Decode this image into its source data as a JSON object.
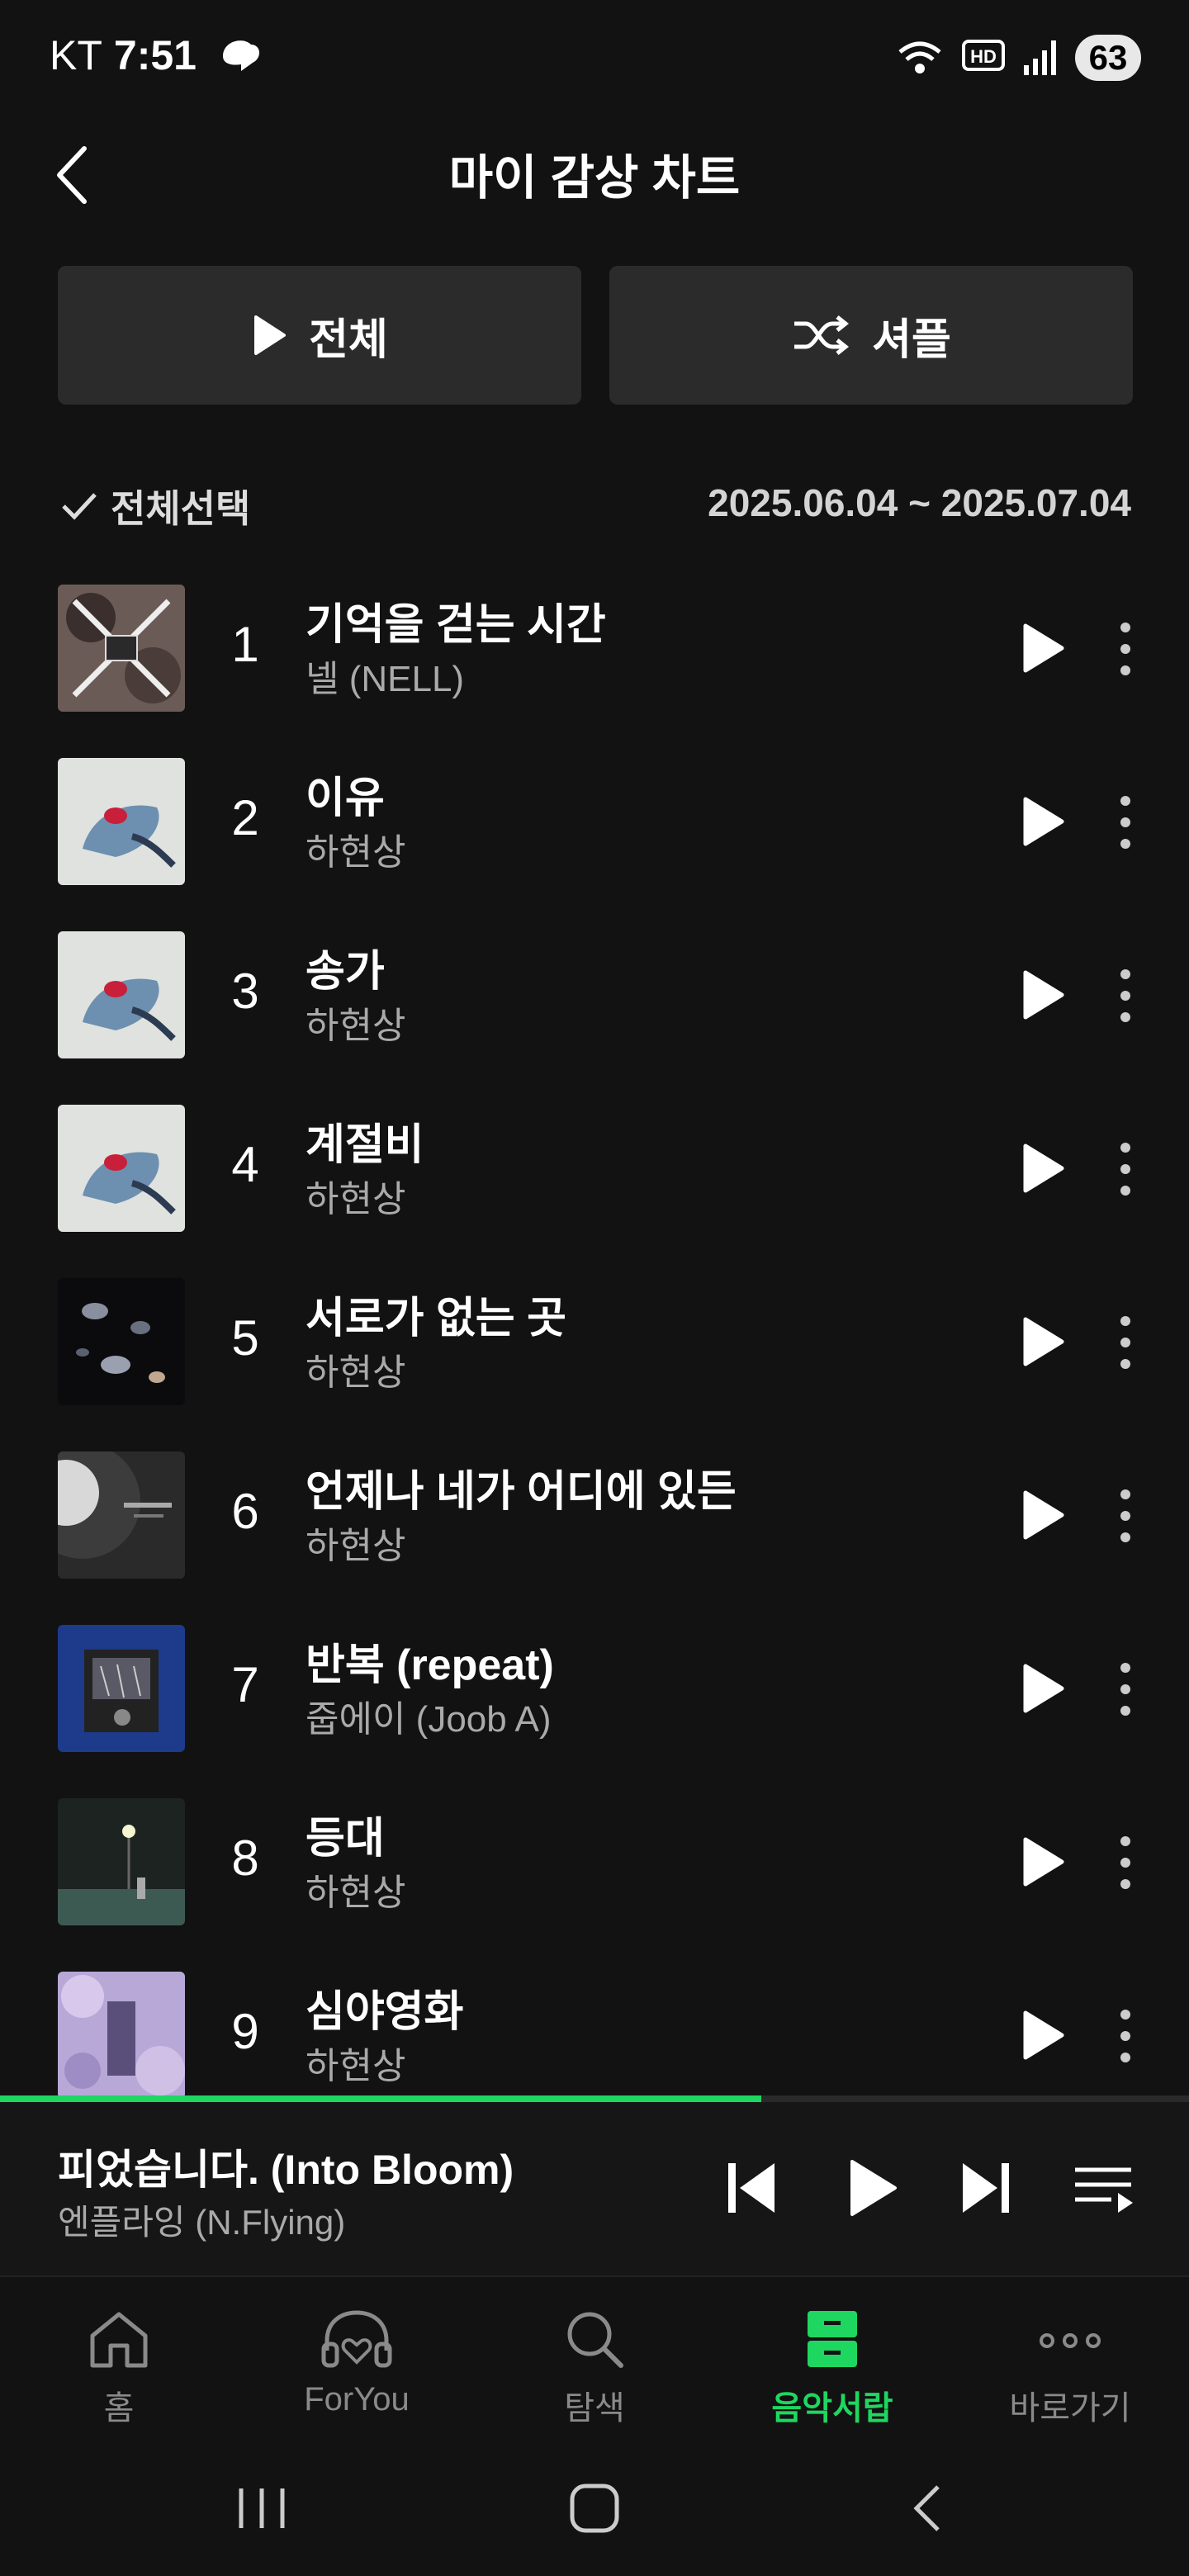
{
  "status": {
    "carrier": "KT",
    "time": "7:51",
    "battery": "63"
  },
  "header": {
    "title": "마이 감상 차트"
  },
  "actions": {
    "play_all": "전체",
    "shuffle": "셔플"
  },
  "select": {
    "select_all": "전체선택",
    "date_range": "2025.06.04 ~ 2025.07.04"
  },
  "songs": [
    {
      "rank": "1",
      "title": "기억을 걷는 시간",
      "artist": "넬 (NELL)"
    },
    {
      "rank": "2",
      "title": "이유",
      "artist": "하현상"
    },
    {
      "rank": "3",
      "title": "송가",
      "artist": "하현상"
    },
    {
      "rank": "4",
      "title": "계절비",
      "artist": "하현상"
    },
    {
      "rank": "5",
      "title": "서로가 없는 곳",
      "artist": "하현상"
    },
    {
      "rank": "6",
      "title": "언제나 네가 어디에 있든",
      "artist": "하현상"
    },
    {
      "rank": "7",
      "title": "반복 (repeat)",
      "artist": "줍에이 (Joob A)"
    },
    {
      "rank": "8",
      "title": "등대",
      "artist": "하현상"
    },
    {
      "rank": "9",
      "title": "심야영화",
      "artist": "하현상"
    }
  ],
  "now_playing": {
    "title": "피었습니다. (Into Bloom)",
    "artist": "엔플라잉 (N.Flying)",
    "progress": 0.64
  },
  "nav": [
    {
      "label": "홈",
      "icon": "home-icon"
    },
    {
      "label": "ForYou",
      "icon": "headphones-heart-icon"
    },
    {
      "label": "탐색",
      "icon": "search-icon"
    },
    {
      "label": "음악서랍",
      "icon": "drawer-icon",
      "active": true
    },
    {
      "label": "바로가기",
      "icon": "more-dots-icon"
    }
  ],
  "colors": {
    "accent": "#1ed760",
    "background": "#121212",
    "button": "#2b2b2b"
  }
}
